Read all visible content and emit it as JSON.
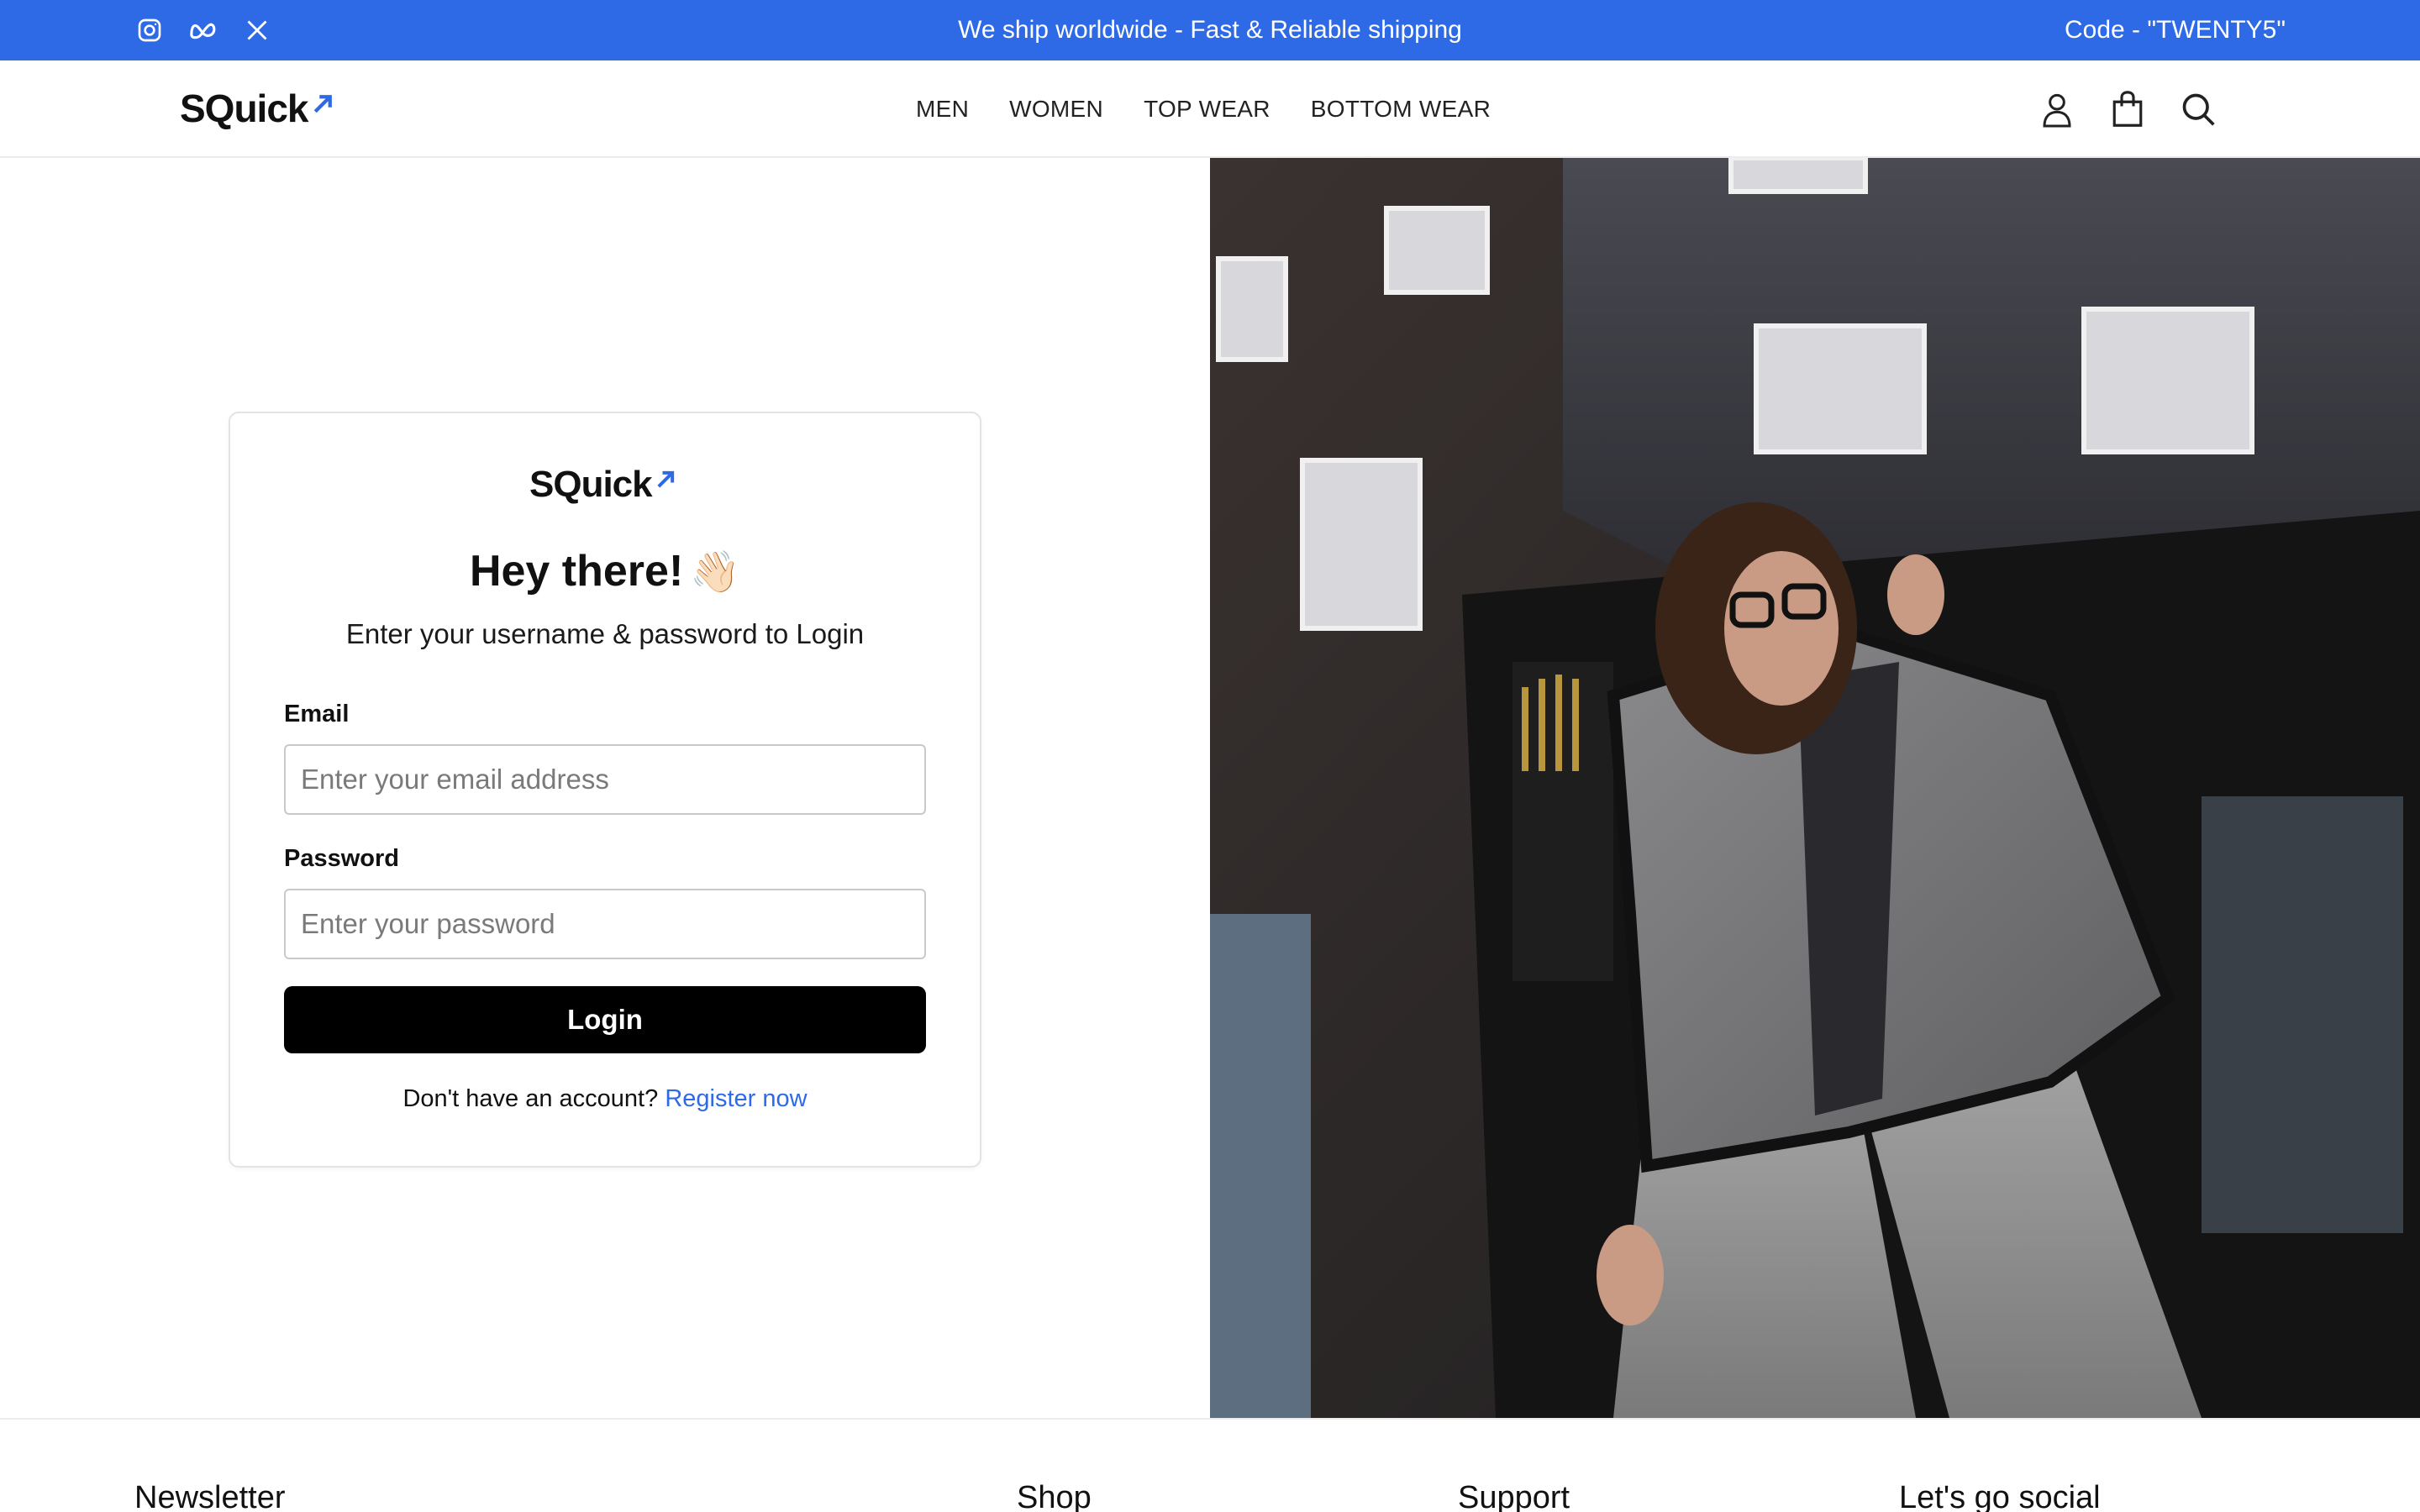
{
  "topbar": {
    "announcement": "We ship worldwide - Fast & Reliable shipping",
    "code": "Code - \"TWENTY5\"",
    "background": "#2f6ae6",
    "social_icons": [
      "instagram-icon",
      "meta-icon",
      "x-icon"
    ]
  },
  "header": {
    "logo_text": "SQuick",
    "nav": [
      {
        "label": "MEN"
      },
      {
        "label": "WOMEN"
      },
      {
        "label": "TOP WEAR"
      },
      {
        "label": "BOTTOM WEAR"
      }
    ],
    "icons": [
      "user-icon",
      "shopping-bag-icon",
      "search-icon"
    ]
  },
  "login": {
    "logo_text": "SQuick",
    "title": "Hey there!",
    "wave_emoji": "👋🏻",
    "subtitle": "Enter your username & password to Login",
    "email_label": "Email",
    "email_placeholder": "Enter your email address",
    "email_value": "",
    "password_label": "Password",
    "password_placeholder": "Enter your password",
    "password_value": "",
    "button_label": "Login",
    "register_prompt": "Don't have an account?",
    "register_link": "Register now",
    "accent": "#2f6ae6"
  },
  "footer": {
    "columns": [
      {
        "title": "Newsletter"
      },
      {
        "title": "Shop"
      },
      {
        "title": "Support"
      },
      {
        "title": "Let's go social"
      }
    ]
  }
}
